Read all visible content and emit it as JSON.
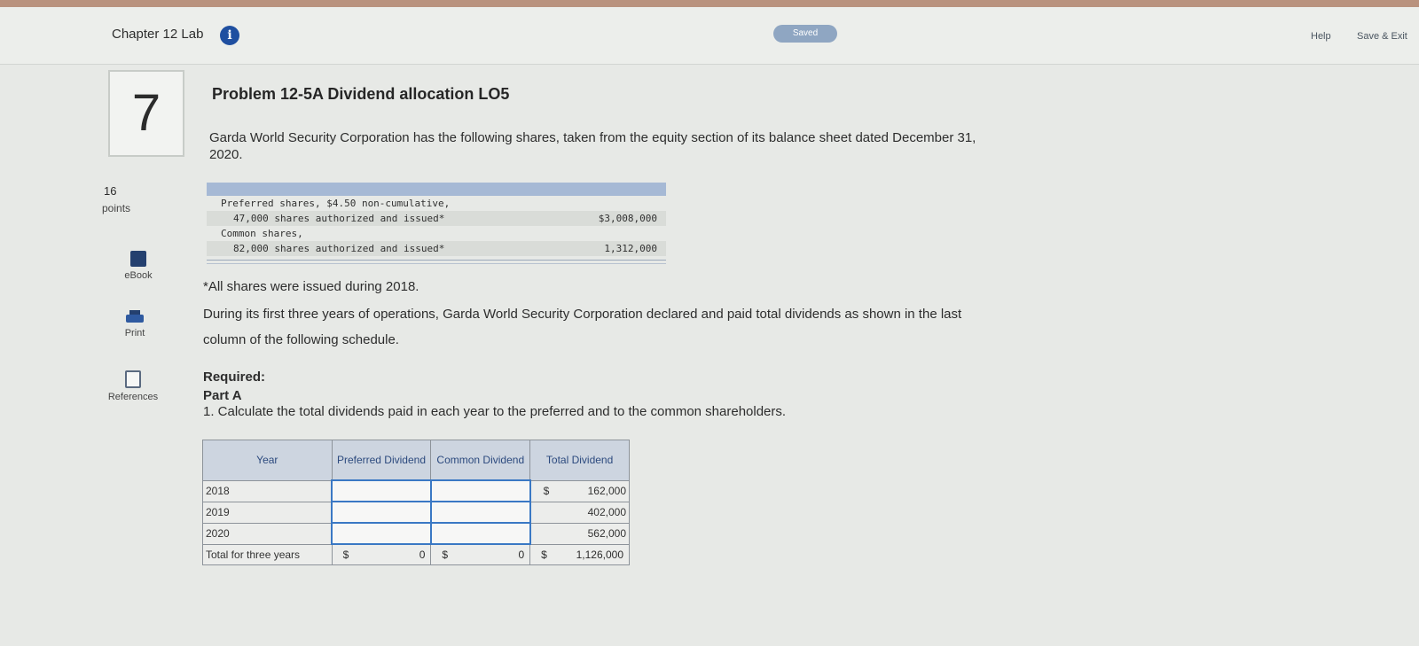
{
  "header": {
    "lab_title": "Chapter 12 Lab",
    "info_glyph": "i",
    "saved": "Saved",
    "help": "Help",
    "save_exit": "Save & Exit"
  },
  "question": {
    "number": "7",
    "points_value": "16",
    "points_label": "points"
  },
  "tools": {
    "ebook": "eBook",
    "print": "Print",
    "references": "References"
  },
  "problem": {
    "title": "Problem 12-5A Dividend allocation LO5",
    "intro_line1": "Garda World Security Corporation has the following shares, taken from the equity section of its balance sheet dated December 31,",
    "intro_line2": "2020.",
    "footnote": "*All shares were issued during 2018.",
    "para2_line1": "During its first three years of operations, Garda World Security Corporation declared and paid total dividends as shown in the last",
    "para2_line2": "column of the following schedule.",
    "required": "Required:",
    "part": "Part A",
    "task": "1. Calculate the total dividends paid in each year to the preferred and to the common shareholders."
  },
  "equity": {
    "pref_line1": "Preferred shares, $4.50 non-cumulative,",
    "pref_line2": "47,000 shares authorized and issued*",
    "pref_amount": "$3,008,000",
    "common_line1": "Common shares,",
    "common_line2": "82,000 shares authorized and issued*",
    "common_amount": "1,312,000"
  },
  "dividends": {
    "headers": {
      "year": "Year",
      "preferred": "Preferred Dividend",
      "common": "Common Dividend",
      "total": "Total Dividend"
    },
    "currency": "$",
    "rows": [
      {
        "year": "2018",
        "total": "162,000"
      },
      {
        "year": "2019",
        "total": "402,000"
      },
      {
        "year": "2020",
        "total": "562,000"
      }
    ],
    "totals": {
      "label": "Total for three years",
      "preferred": "0",
      "common": "0",
      "total": "1,126,000"
    }
  }
}
